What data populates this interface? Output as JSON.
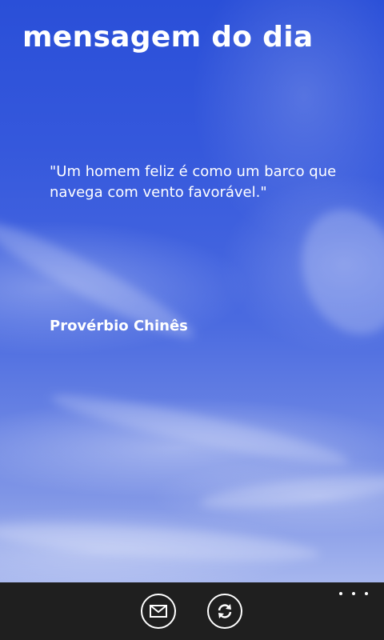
{
  "page": {
    "title": "mensagem do dia"
  },
  "message": {
    "quote": "\"Um homem feliz é como um barco que navega com vento favorável.\"",
    "author": "Provérbio Chinês"
  },
  "app_bar": {
    "buttons": [
      {
        "icon": "mail-icon"
      },
      {
        "icon": "refresh-icon"
      }
    ],
    "more_icon": "ellipsis-icon",
    "background": "#1f1f1f"
  },
  "colors": {
    "sky_top": "#2a4fd8",
    "sky_bottom": "#a6b6ee",
    "text": "#ffffff"
  }
}
